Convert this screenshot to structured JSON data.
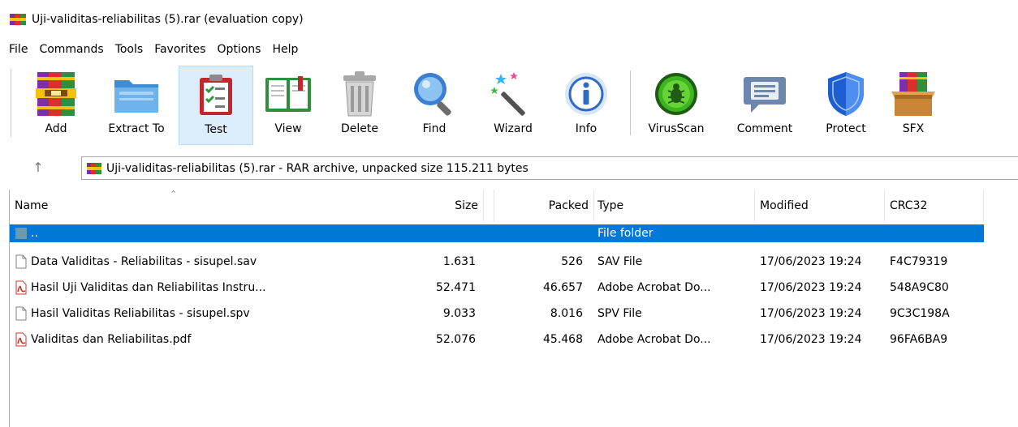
{
  "window": {
    "title": "Uji-validitas-reliabilitas (5).rar (evaluation copy)",
    "app_icon": "winrar-books-icon"
  },
  "menu": [
    "File",
    "Commands",
    "Tools",
    "Favorites",
    "Options",
    "Help"
  ],
  "toolbar": [
    {
      "label": "Add",
      "icon": "winrar-add-books-icon"
    },
    {
      "label": "Extract To",
      "icon": "folder-extract-icon"
    },
    {
      "label": "Test",
      "icon": "clipboard-check-icon",
      "selected": true
    },
    {
      "label": "View",
      "icon": "open-book-icon"
    },
    {
      "label": "Delete",
      "icon": "trash-can-icon"
    },
    {
      "label": "Find",
      "icon": "magnifier-icon"
    },
    {
      "label": "Wizard",
      "icon": "magic-wand-icon"
    },
    {
      "label": "Info",
      "icon": "info-circle-icon"
    },
    {
      "label": "VirusScan",
      "icon": "virus-bug-icon"
    },
    {
      "label": "Comment",
      "icon": "speech-bubble-icon"
    },
    {
      "label": "Protect",
      "icon": "shield-icon"
    },
    {
      "label": "SFX",
      "icon": "sfx-box-icon"
    }
  ],
  "address": {
    "up_icon": "up-arrow-icon",
    "text": "Uji-validitas-reliabilitas (5).rar - RAR archive, unpacked size 115.211 bytes"
  },
  "columns": {
    "name": "Name",
    "size": "Size",
    "packed": "Packed",
    "type": "Type",
    "modified": "Modified",
    "crc": "CRC32"
  },
  "rows": [
    {
      "name": "..",
      "size": "",
      "packed": "",
      "type": "File folder",
      "modified": "",
      "crc": "",
      "icon": "parent-folder-icon",
      "selected": true
    },
    {
      "name": "Data Validitas - Reliabilitas - sisupel.sav",
      "size": "1.631",
      "packed": "526",
      "type": "SAV File",
      "modified": "17/06/2023 19:24",
      "crc": "F4C79319",
      "icon": "blank-file-icon"
    },
    {
      "name": "Hasil Uji Validitas dan Reliabilitas Instru...",
      "size": "52.471",
      "packed": "46.657",
      "type": "Adobe Acrobat Do...",
      "modified": "17/06/2023 19:24",
      "crc": "548A9C80",
      "icon": "pdf-file-icon"
    },
    {
      "name": "Hasil Validitas Reliabilitas - sisupel.spv",
      "size": "9.033",
      "packed": "8.016",
      "type": "SPV File",
      "modified": "17/06/2023 19:24",
      "crc": "9C3C198A",
      "icon": "blank-file-icon"
    },
    {
      "name": "Validitas dan Reliabilitas.pdf",
      "size": "52.076",
      "packed": "45.468",
      "type": "Adobe Acrobat Do...",
      "modified": "17/06/2023 19:24",
      "crc": "96FA6BA9",
      "icon": "pdf-file-icon"
    }
  ],
  "colors": {
    "selection": "#0078d7",
    "toolbar_selected": "#dceefb"
  }
}
